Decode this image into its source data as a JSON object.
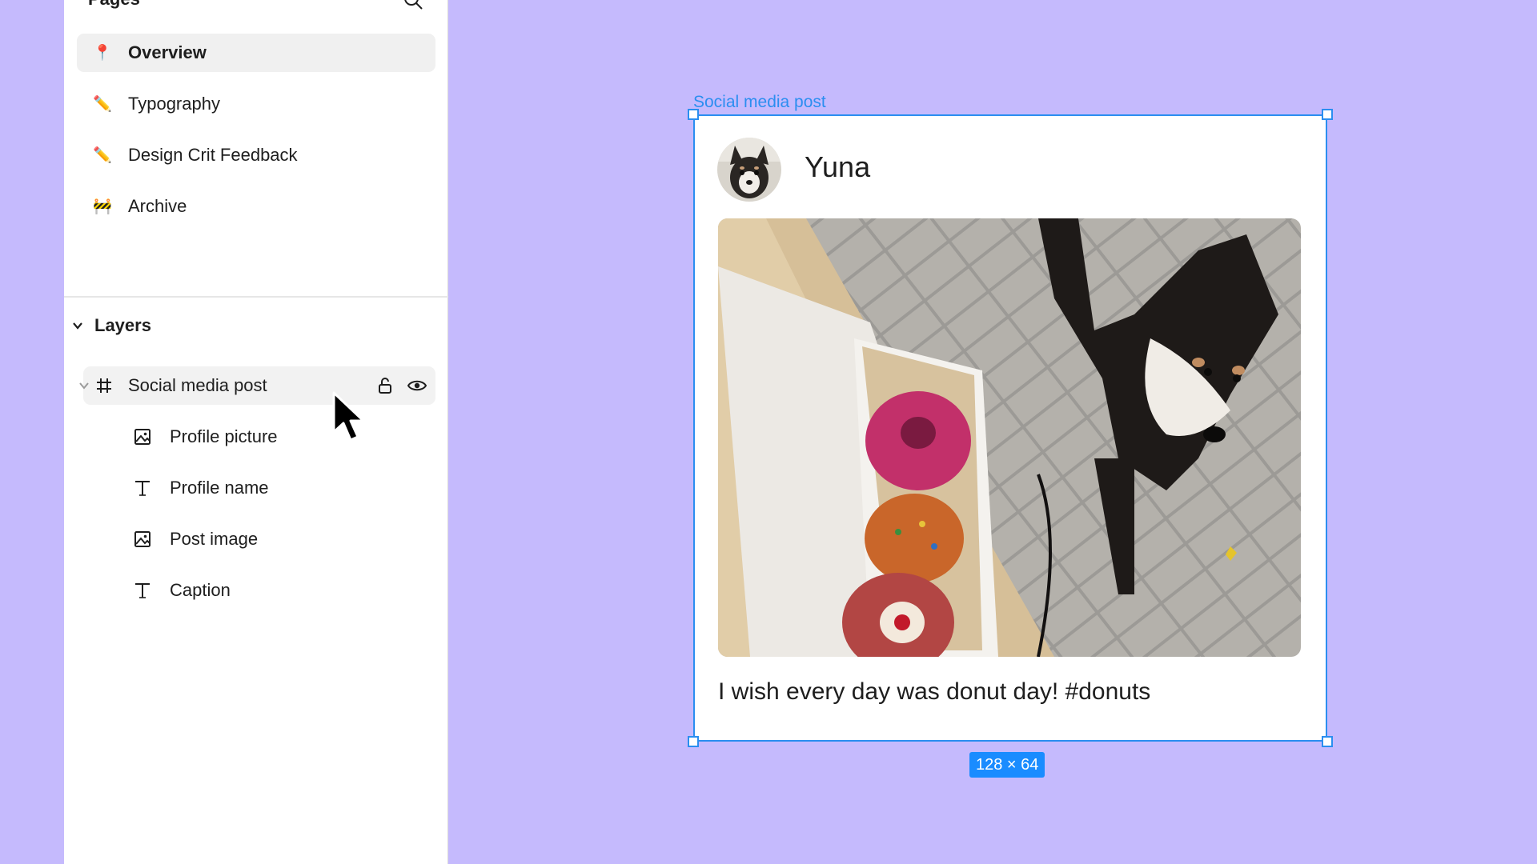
{
  "pages": {
    "title": "Pages",
    "items": [
      {
        "emoji": "📍",
        "label": "Overview",
        "active": true
      },
      {
        "emoji": "✏️",
        "label": "Typography",
        "active": false
      },
      {
        "emoji": "✏️",
        "label": "Design Crit Feedback",
        "active": false
      },
      {
        "emoji": "🚧",
        "label": "Archive",
        "active": false
      }
    ]
  },
  "layers": {
    "title": "Layers",
    "frame": {
      "label": "Social media post",
      "icon": "frame-hash-icon"
    },
    "children": [
      {
        "label": "Profile picture",
        "icon": "image-icon"
      },
      {
        "label": "Profile name",
        "icon": "text-icon"
      },
      {
        "label": "Post image",
        "icon": "image-icon"
      },
      {
        "label": "Caption",
        "icon": "text-icon"
      }
    ]
  },
  "canvas": {
    "frame_label": "Social media post",
    "profile_name": "Yuna",
    "caption": "I wish every day was donut day! #donuts",
    "size_badge": "128 × 64",
    "selection_color": "#2b8ef0",
    "background_color": "#c5bafd"
  }
}
